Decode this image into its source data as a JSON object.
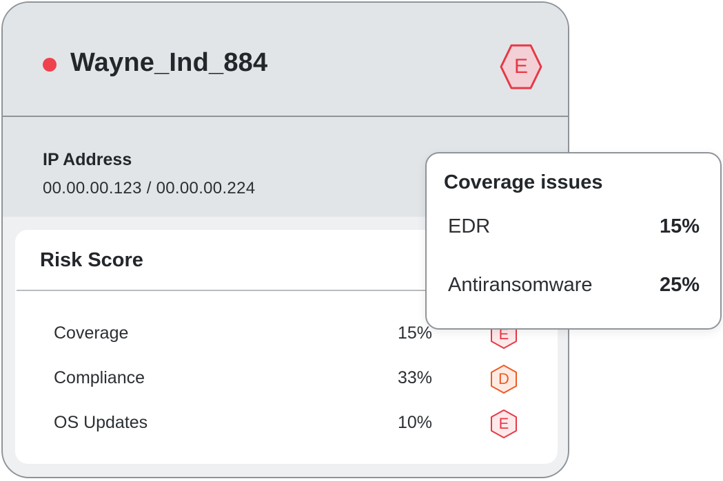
{
  "device": {
    "name": "Wayne_Ind_884",
    "status_color": "#f0414e",
    "grade": "E",
    "grade_color": "#e63946"
  },
  "ip": {
    "label": "IP Address",
    "value": "00.00.00.123  / 00.00.00.224"
  },
  "risk": {
    "title": "Risk Score",
    "rows": [
      {
        "label": "Coverage",
        "value": "15%",
        "grade": "E",
        "grade_color": "#e63946"
      },
      {
        "label": "Compliance",
        "value": "33%",
        "grade": "D",
        "grade_color": "#ee5a24"
      },
      {
        "label": "OS Updates",
        "value": "10%",
        "grade": "E",
        "grade_color": "#e63946"
      }
    ]
  },
  "popover": {
    "title": "Coverage issues",
    "items": [
      {
        "label": "EDR",
        "value": "15%"
      },
      {
        "label": "Antiransomware",
        "value": "25%"
      }
    ]
  }
}
